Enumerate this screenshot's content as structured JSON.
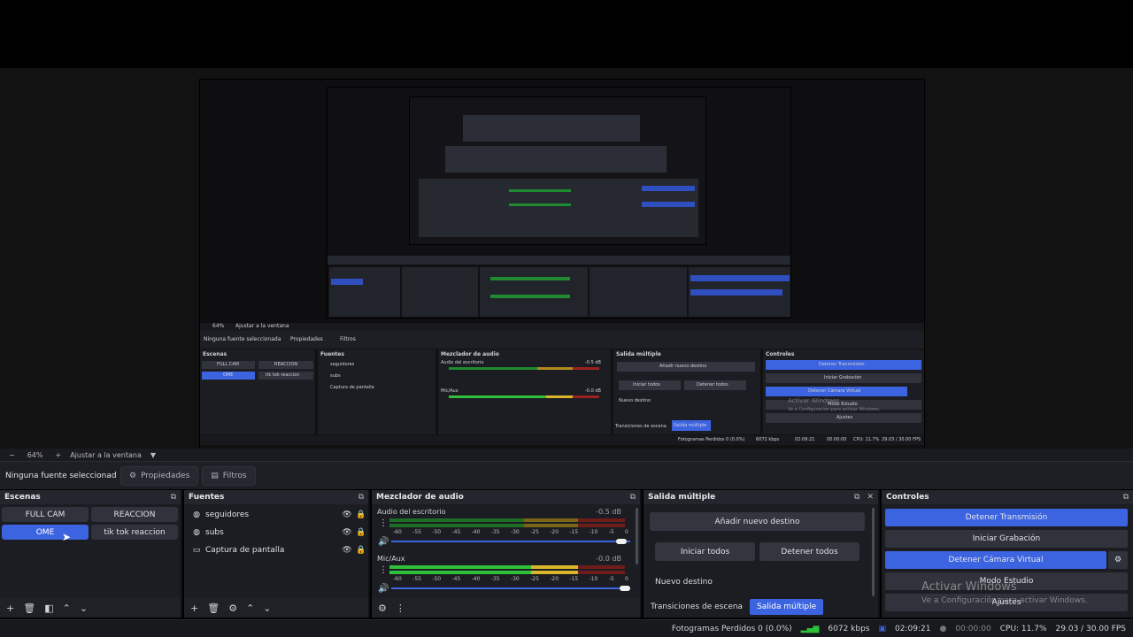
{
  "preview": {
    "nested": {
      "zoom": "64%",
      "fit": "Ajustar a la ventana",
      "no_source": "Ninguna fuente seleccionada",
      "properties": "Propiedades",
      "filters": "Filtros",
      "scenes_title": "Escenas",
      "scenes": [
        "FULL CAM",
        "REACCION",
        "OME",
        "tik tok reaccion"
      ],
      "sources_title": "Fuentes",
      "sources": [
        "seguidores",
        "subs",
        "Captura de pantalla"
      ],
      "mixer_title": "Mezclador de audio",
      "desktop_audio": "Audio del escritorio",
      "desktop_db": "-0.5 dB",
      "mic": "Mic/Aux",
      "mic_db": "-0.0 dB",
      "output_title": "Salida múltiple",
      "add_destination": "Añadir nuevo destino",
      "start_all": "Iniciar todos",
      "stop_all": "Detener todos",
      "new_destination": "Nuevo destino",
      "tab_transitions": "Transiciones de escena",
      "tab_multi": "Salida múltiple",
      "controls_title": "Controles",
      "stop_stream": "Detener Transmisión",
      "start_rec": "Iniciar Grabación",
      "stop_vcam": "Detener Cámara Virtual",
      "studio": "Modo Estudio",
      "settings": "Ajustes",
      "frames": "Fotogramas Perdidos 0 (0.0%)",
      "kbps": "6072 kbps",
      "time": "02:09:21",
      "rec_time": "00:00:00",
      "cpu": "CPU: 11.7%",
      "fps": "29.03 / 30.00 FPS",
      "wm1": "Activar Windows",
      "wm2": "Ve a Configuración para activar Windows."
    }
  },
  "zoom_bar": {
    "minus": "−",
    "zoom": "64%",
    "plus": "+",
    "fit": "Ajustar a la ventana"
  },
  "source_bar": {
    "no_source": "Ninguna fuente seleccionad",
    "properties": "Propiedades",
    "filters": "Filtros"
  },
  "scenes": {
    "title": "Escenas",
    "items": [
      "FULL CAM",
      "REACCION",
      "OME",
      "tik tok reaccion"
    ],
    "active": "OME"
  },
  "sources": {
    "title": "Fuentes",
    "items": [
      {
        "label": "seguidores",
        "icon": "globe-icon"
      },
      {
        "label": "subs",
        "icon": "globe-icon"
      },
      {
        "label": "Captura de pantalla",
        "icon": "monitor-icon"
      }
    ]
  },
  "mixer": {
    "title": "Mezclador de audio",
    "scale": [
      "-60",
      "-55",
      "-50",
      "-45",
      "-40",
      "-35",
      "-30",
      "-25",
      "-20",
      "-15",
      "-10",
      "-5",
      "0"
    ],
    "channels": [
      {
        "name": "Audio del escritorio",
        "db": "-0.5 dB",
        "level": 0.55,
        "volume": 0.97
      },
      {
        "name": "Mic/Aux",
        "db": "-0.0 dB",
        "level": 0.6,
        "volume": 0.99
      }
    ]
  },
  "output": {
    "title": "Salida múltiple",
    "add_destination": "Añadir nuevo destino",
    "start_all": "Iniciar todos",
    "stop_all": "Detener todos",
    "new_destination": "Nuevo destino",
    "tabs": [
      "Transiciones de escena",
      "Salida múltiple"
    ],
    "active_tab": "Salida múltiple"
  },
  "controls": {
    "title": "Controles",
    "stop_stream": "Detener Transmisión",
    "start_rec": "Iniciar Grabación",
    "stop_vcam": "Detener Cámara Virtual",
    "studio": "Modo Estudio",
    "settings": "Ajustes"
  },
  "watermark": {
    "line1": "Activar Windows",
    "line2": "Ve a Configuración para activar Windows."
  },
  "status": {
    "frames": "Fotogramas Perdidos 0 (0.0%)",
    "kbps": "6072 kbps",
    "stream_time": "02:09:21",
    "rec_time": "00:00:00",
    "cpu": "CPU: 11.7%",
    "fps": "29.03 / 30.00 FPS"
  },
  "colors": {
    "accent": "#3c64e0",
    "meter_green": "#2fbf3a",
    "meter_yellow": "#d9b62a",
    "meter_red": "#c9302c"
  }
}
